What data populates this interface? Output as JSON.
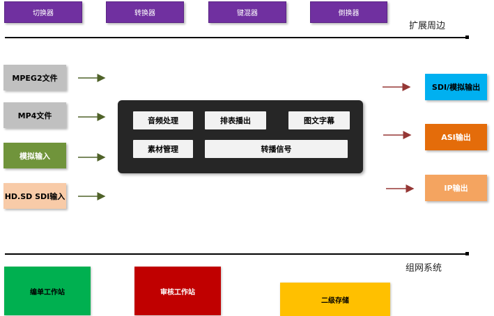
{
  "top_boxes": [
    "切换器",
    "转换器",
    "键混器",
    "倒换器"
  ],
  "sections": {
    "expansion": "扩展周边",
    "network": "组网系统"
  },
  "sources": [
    {
      "label": "MPEG2文件",
      "color": "#c0c0c0"
    },
    {
      "label": "MP4文件",
      "color": "#c0c0c0"
    },
    {
      "label": "模拟输入",
      "color": "#70943b"
    },
    {
      "label": "HD.SD SDI输入",
      "color": "#f8cba8"
    }
  ],
  "center": {
    "items": [
      "音频处理",
      "排表播出",
      "图文字幕",
      "素材管理",
      "转播信号"
    ],
    "color": "#262626"
  },
  "outputs": [
    {
      "label": "SDI/模拟输出",
      "color": "#00b0f0"
    },
    {
      "label": "ASI输出",
      "color": "#e46c0a"
    },
    {
      "label": "IP输出",
      "color": "#f4a460"
    }
  ],
  "bottom": [
    {
      "label": "编单工作站",
      "color": "#00b050"
    },
    {
      "label": "审核工作站",
      "color": "#c00000"
    },
    {
      "label": "二级存储",
      "color": "#ffc000"
    }
  ],
  "colors": {
    "top_box": "#7030a0",
    "input_arrow": "#4f6228",
    "output_arrow": "#953735"
  }
}
